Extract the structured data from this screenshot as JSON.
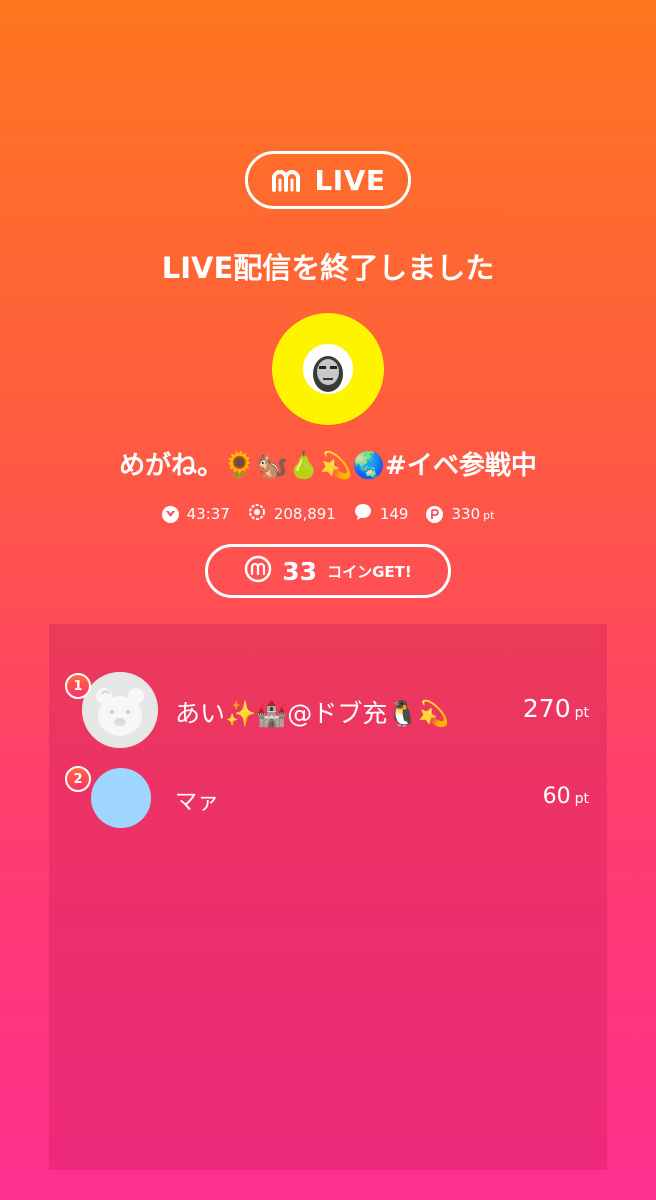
{
  "header": {
    "logo_text": "LIVE",
    "title": "LIVE配信を終了しました"
  },
  "streamer": {
    "name": "めがね。🌻🐿️🍐💫🌏#イベ参戦中",
    "avatar_bg_color": "#fff400"
  },
  "stats": {
    "duration": "43:37",
    "viewers": "208,891",
    "comments": "149",
    "points": "330",
    "points_unit": "pt",
    "icons": [
      "heart-icon",
      "eye-icon",
      "comment-icon",
      "point-icon"
    ]
  },
  "coins": {
    "count": "33",
    "label": "コインGET!"
  },
  "ranking": [
    {
      "rank": "1",
      "name": "あい✨🏰@ドブ充🐧💫",
      "points": "270",
      "unit": "pt",
      "avatar": "bear-icon"
    },
    {
      "rank": "2",
      "name": "マァ",
      "points": "60",
      "unit": "pt",
      "avatar": "blank-avatar",
      "avatar_color": "#9ed6ff"
    }
  ]
}
